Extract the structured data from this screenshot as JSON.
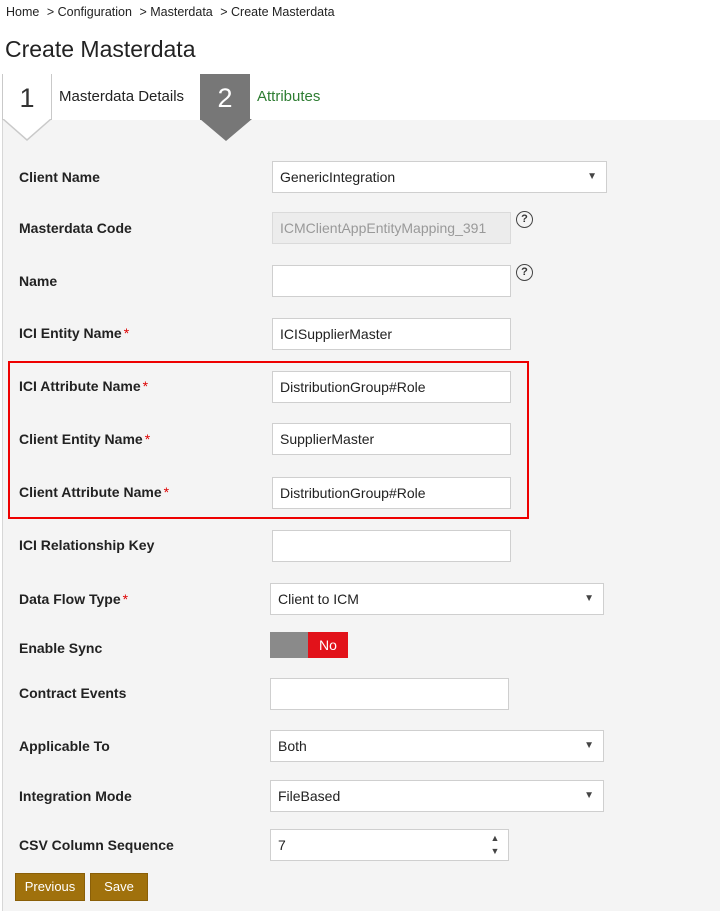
{
  "breadcrumb": {
    "home": "Home",
    "configuration": "> Configuration",
    "masterdata": "> Masterdata",
    "current": "> Create Masterdata"
  },
  "page_title": "Create Masterdata",
  "wizard": {
    "step1": {
      "number": "1",
      "label": "Masterdata Details"
    },
    "step2": {
      "number": "2",
      "label": "Attributes"
    }
  },
  "form": {
    "client_name": {
      "label": "Client Name",
      "value": "GenericIntegration"
    },
    "masterdata_code": {
      "label": "Masterdata Code",
      "value": "ICMClientAppEntityMapping_391"
    },
    "name": {
      "label": "Name",
      "value": ""
    },
    "ici_entity_name": {
      "label": "ICI Entity Name",
      "value": "ICISupplierMaster"
    },
    "ici_attribute_name": {
      "label": "ICI Attribute Name",
      "value": "DistributionGroup#Role"
    },
    "client_entity_name": {
      "label": "Client Entity Name",
      "value": "SupplierMaster"
    },
    "client_attribute_name": {
      "label": "Client Attribute Name",
      "value": "DistributionGroup#Role"
    },
    "ici_relationship_key": {
      "label": "ICI Relationship Key",
      "value": ""
    },
    "data_flow_type": {
      "label": "Data Flow Type",
      "value": "Client to ICM"
    },
    "enable_sync": {
      "label": "Enable Sync",
      "value": "No"
    },
    "contract_events": {
      "label": "Contract Events",
      "value": ""
    },
    "applicable_to": {
      "label": "Applicable To",
      "value": "Both"
    },
    "integration_mode": {
      "label": "Integration Mode",
      "value": "FileBased"
    },
    "csv_column_sequence": {
      "label": "CSV Column Sequence",
      "value": "7"
    },
    "required_marker": "*"
  },
  "icons": {
    "help": "?",
    "dropdown": "▼",
    "spin_up": "▲",
    "spin_down": "▼"
  },
  "buttons": {
    "previous": "Previous",
    "save": "Save"
  },
  "colors": {
    "accent_button": "#a0710c",
    "toggle_no": "#e2121a",
    "active_step": "#2e7d32",
    "highlight": "#e00000"
  }
}
